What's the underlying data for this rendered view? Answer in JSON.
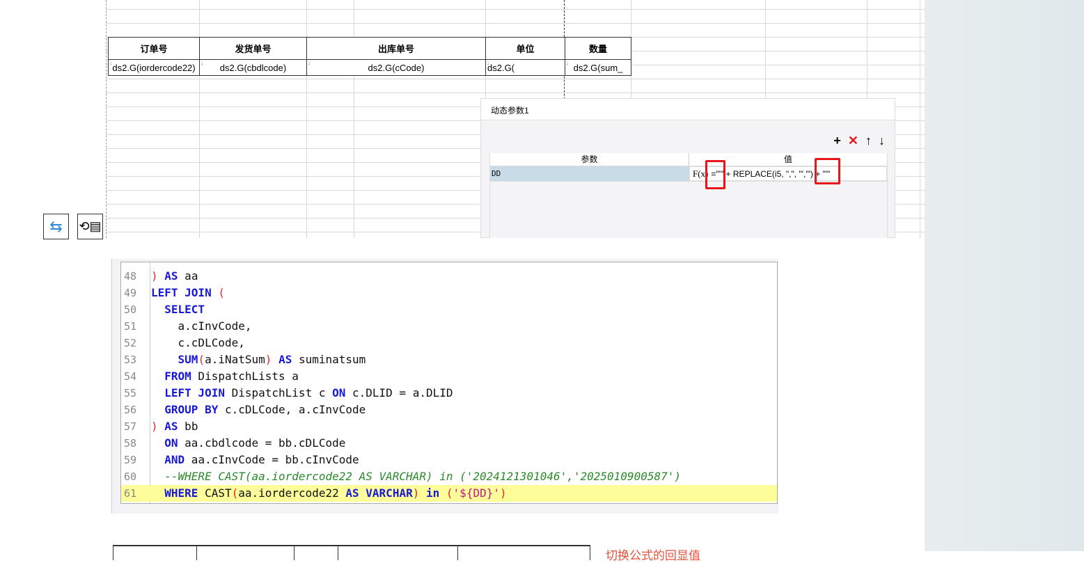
{
  "sheet": {
    "headers": [
      "订单号",
      "发货单号",
      "出库单号",
      "单位",
      "数量"
    ],
    "row": [
      "ds2.G(iordercode22)",
      "ds2.G(cbdlcode)",
      "ds2.G(cCode)",
      "ds2.G(",
      "ds2.G(sum_"
    ]
  },
  "dialog": {
    "title": "动态参数1",
    "col_param": "参数",
    "col_value": "值",
    "param_name": "DD",
    "fx_label": "F(x)",
    "value_prefix": "=\"'\"",
    "value_mid": " + REPLACE(i5, \",\", \"','\") + ",
    "value_suffix": "\"'\""
  },
  "toolbar": {
    "add": "+",
    "delete": "✕",
    "up": "↑",
    "down": "↓"
  },
  "code": [
    {
      "n": "48",
      "html": "<span class='pr'>)</span> <span class='kw'>AS</span> aa"
    },
    {
      "n": "49",
      "html": "<span class='kw'>LEFT JOIN</span> <span class='pr'>(</span>"
    },
    {
      "n": "50",
      "html": "  <span class='kw'>SELECT</span>"
    },
    {
      "n": "51",
      "html": "    a.cInvCode,"
    },
    {
      "n": "52",
      "html": "    c.cDLCode,"
    },
    {
      "n": "53",
      "html": "    <span class='kw'>SUM</span><span class='pr'>(</span>a.iNatSum<span class='pr'>)</span> <span class='kw'>AS</span> suminatsum"
    },
    {
      "n": "54",
      "html": "  <span class='kw'>FROM</span> DispatchLists a"
    },
    {
      "n": "55",
      "html": "  <span class='kw'>LEFT JOIN</span> DispatchList c <span class='kw'>ON</span> c.DLID = a.DLID"
    },
    {
      "n": "56",
      "html": "  <span class='kw'>GROUP BY</span> c.cDLCode, a.cInvCode"
    },
    {
      "n": "57",
      "html": "<span class='pr'>)</span> <span class='kw'>AS</span> bb"
    },
    {
      "n": "58",
      "html": "  <span class='kw'>ON</span> aa.cbdlcode = bb.cDLCode"
    },
    {
      "n": "59",
      "html": "  <span class='kw'>AND</span> aa.cInvCode = bb.cInvCode"
    },
    {
      "n": "60",
      "html": "  <span class='cm'>--WHERE CAST(aa.iordercode22 AS VARCHAR) in ('2024121301046','2025010900587')</span>"
    },
    {
      "n": "61",
      "html": "  <span class='kw'>WHERE</span> CAST<span class='pr'>(</span>aa.iordercode22 <span class='kw'>AS</span> <span class='kw'>VARCHAR</span><span class='pr'>)</span> <span class='kw'>in</span> <span class='pr'>(</span><span class='st'>'${DD}'</span><span class='pr'>)</span>"
    }
  ],
  "note": "切换公式的回显值"
}
